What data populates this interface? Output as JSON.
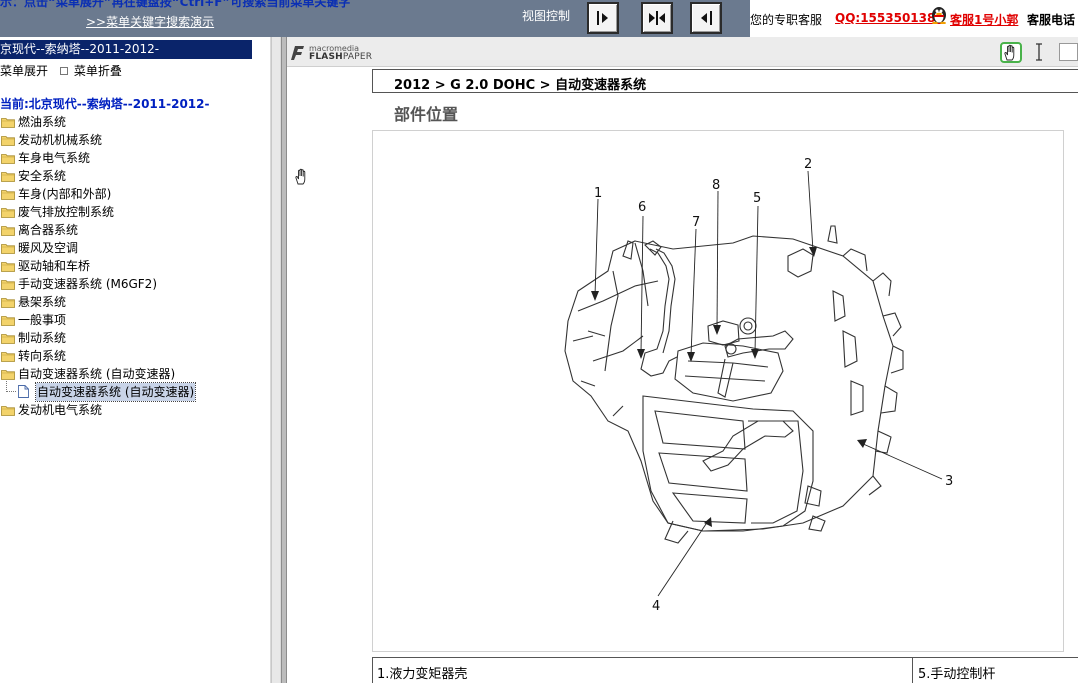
{
  "top_bar": {
    "hint_text": "示：点击“菜单展开”再在键盘按“Ctrl+F”可搜索当前菜单关键字",
    "hint_link": ">>菜单关键字搜索演示",
    "view_label": "视图控制",
    "view_buttons": [
      "right-pane-icon",
      "split-pane-icon",
      "left-pane-icon"
    ],
    "service_label": "您的专职客服",
    "service_qq": "QQ:1553501388",
    "service_name": "客服1号小郭",
    "service_tail": "客服电话"
  },
  "menu": {
    "header": "京现代--索纳塔--2011-2012-",
    "expand_label": "菜单展开",
    "collapse_label": "菜单折叠",
    "current_label": "当前:北京现代--索纳塔--2011-2012-",
    "items": [
      {
        "label": "燃油系统",
        "type": "folder"
      },
      {
        "label": "发动机机械系统",
        "type": "folder"
      },
      {
        "label": "车身电气系统",
        "type": "folder"
      },
      {
        "label": "安全系统",
        "type": "folder"
      },
      {
        "label": "车身(内部和外部)",
        "type": "folder"
      },
      {
        "label": "废气排放控制系统",
        "type": "folder"
      },
      {
        "label": "离合器系统",
        "type": "folder"
      },
      {
        "label": "暖风及空调",
        "type": "folder"
      },
      {
        "label": "驱动轴和车桥",
        "type": "folder"
      },
      {
        "label": "手动变速器系统 (M6GF2)",
        "type": "folder"
      },
      {
        "label": "悬架系统",
        "type": "folder"
      },
      {
        "label": "一般事项",
        "type": "folder"
      },
      {
        "label": "制动系统",
        "type": "folder"
      },
      {
        "label": "转向系统",
        "type": "folder"
      },
      {
        "label": "自动变速器系统 (自动变速器)",
        "type": "folder-open"
      },
      {
        "label": "自动变速器系统 (自动变速器)",
        "type": "doc",
        "selected": true
      },
      {
        "label": "发动机电气系统",
        "type": "folder"
      }
    ]
  },
  "viewer": {
    "logo_macro": "macromedia",
    "logo_flash": "FLASH",
    "logo_paper": "PAPER",
    "tools": [
      "hand-tool-icon",
      "text-select-icon",
      "zoom-box"
    ],
    "document": {
      "title": "2012 > G 2.0 DOHC > 自动变速器系统",
      "section": "部件位置",
      "callouts": [
        "1",
        "2",
        "3",
        "4",
        "5",
        "6",
        "7",
        "8"
      ],
      "legend": [
        "1.液力变矩器壳",
        "5.手动控制杆"
      ]
    }
  },
  "colors": {
    "top_bar_bg": "#6b7a8f",
    "menu_header_bg": "#0a246a",
    "hint_text": "#0a2fb4",
    "service_red": "#e00000",
    "selected_bg": "#c9d4e8",
    "hand_tool_border": "#49b24a"
  }
}
